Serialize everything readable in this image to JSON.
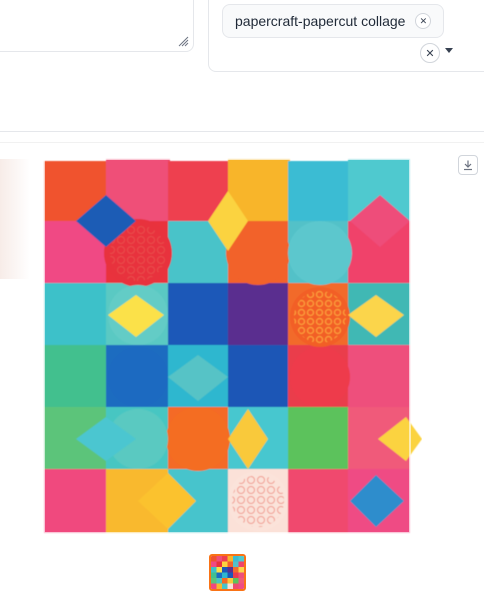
{
  "style_selector": {
    "selected_tag": "papercraft-papercut collage"
  },
  "icons": {
    "tag_remove": "close-icon",
    "clear_all": "close-icon",
    "dropdown": "chevron-down-icon",
    "download": "download-icon",
    "resize": "resize-handle-icon"
  },
  "colors": {
    "accent": "#f97316",
    "border": "#e5e7eb",
    "chip_bg": "#f9fafb"
  }
}
